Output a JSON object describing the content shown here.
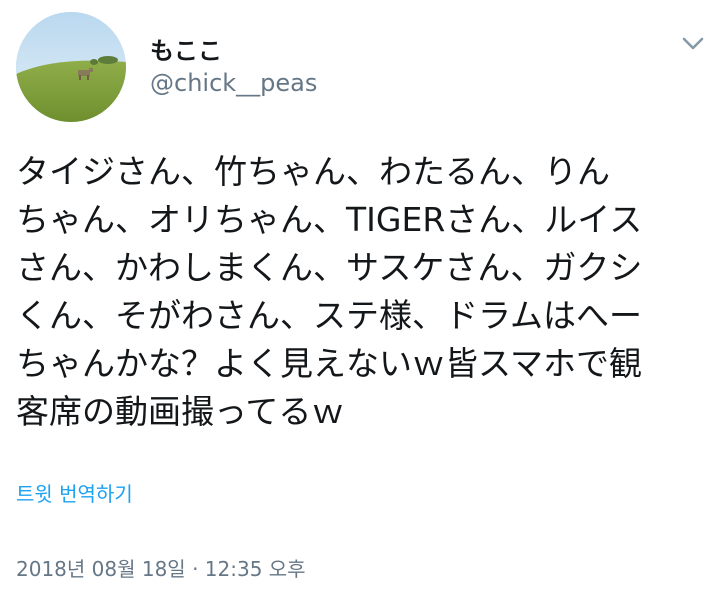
{
  "user": {
    "display_name": "もここ",
    "handle": "@chick__peas"
  },
  "menu": {
    "icon": "chevron-down-icon"
  },
  "tweet": {
    "text": "タイジさん、竹ちゃん、わたるん、りん\nちゃん、オリちゃん、TIGERさん、ルイス\nさん、かわしまくん、サスケさん、ガクシ\nくん、そがわさん、ステ様、ドラムはへー\nちゃんかな？よく見えないｗ皆スマホで観\n客席の動画撮ってるｗ",
    "translate_label": "트윗 번역하기",
    "timestamp": "2018년 08월 18일 · 12:35 오후"
  },
  "colors": {
    "text": "#14171a",
    "secondary": "#657786",
    "link": "#1da1f2"
  }
}
